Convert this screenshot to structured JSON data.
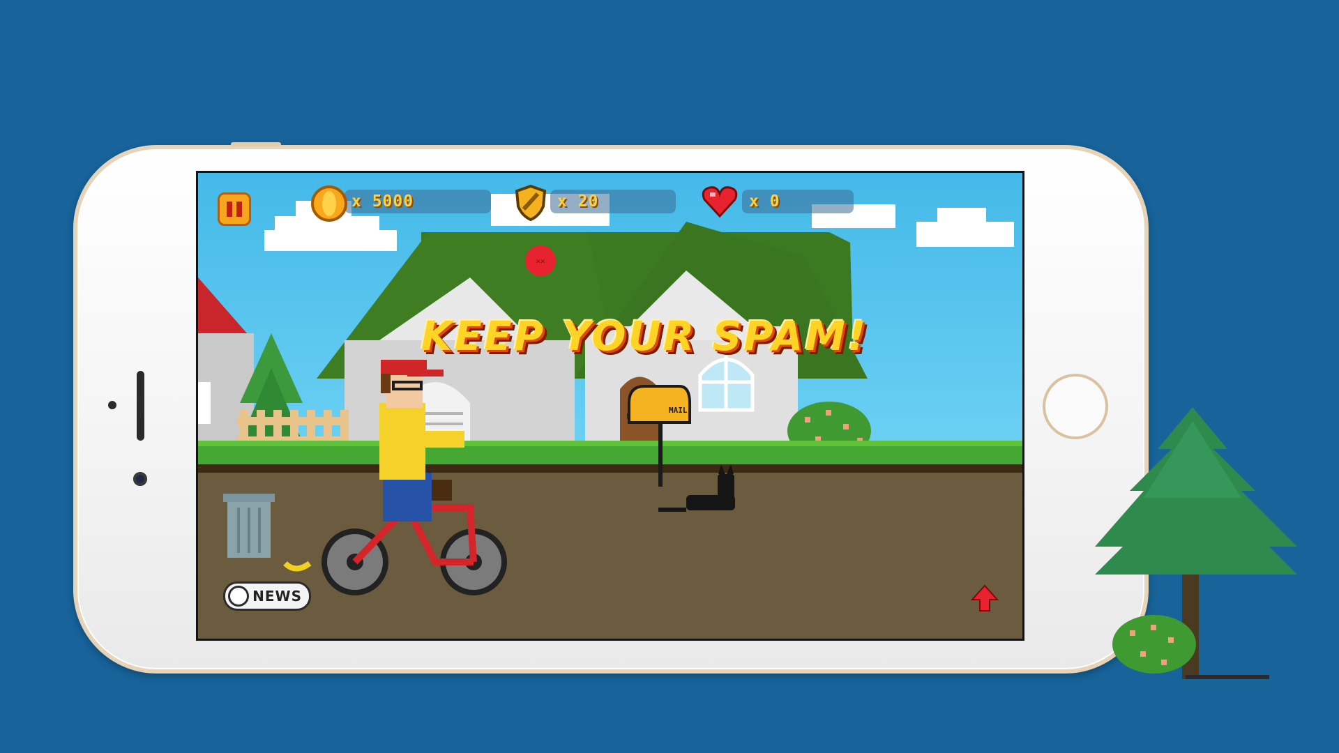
{
  "hud": {
    "coins": "x 5000",
    "shields": "x 20",
    "lives": "x 0"
  },
  "banner": {
    "title": "KEEP YOUR SPAM!"
  },
  "scene": {
    "mailbox_label": "MAIL"
  },
  "controls": {
    "news_button": "NEWS"
  },
  "colors": {
    "background": "#17639a",
    "sky": "#44b9e8",
    "roof": "#3f7d22",
    "title_text": "#ffd424",
    "title_outline": "#e24a00",
    "coin": "#f8a81a",
    "heart": "#e8232f"
  },
  "icons": [
    "pause-icon",
    "coin-icon",
    "shield-icon",
    "heart-icon",
    "news-icon",
    "up-arrow-icon"
  ]
}
